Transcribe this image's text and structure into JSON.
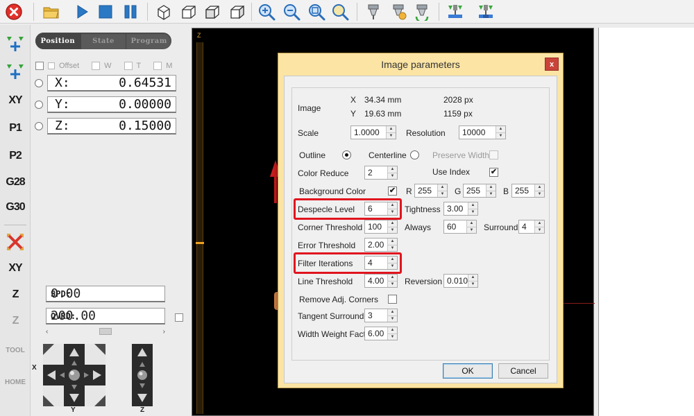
{
  "toolbar": {
    "icons": [
      "stop-icon",
      "open-folder-icon",
      "play-icon",
      "stop-square-icon",
      "pause-icon",
      "cube-view-1-icon",
      "cube-view-2-icon",
      "cube-view-3-icon",
      "cube-view-4-icon",
      "zoom-in-icon",
      "zoom-out-icon",
      "zoom-fit-icon",
      "zoom-window-icon",
      "spindle-icon",
      "spindle-tool-icon",
      "spindle-reset-icon",
      "probe-1-icon",
      "probe-2-icon"
    ]
  },
  "left_strip": {
    "xy_label": "XY",
    "p1_label": "P1",
    "p2_label": "P2",
    "g28_label": "G28",
    "g30_label": "G30",
    "xy2_label": "XY",
    "z_label": "Z",
    "z2_label": "Z",
    "tool_label": "TOOL",
    "home_label": "HOME"
  },
  "dro": {
    "tabs": [
      "Position",
      "State",
      "Program"
    ],
    "options": [
      "Offset",
      "W",
      "T",
      "M"
    ],
    "axes": [
      {
        "label": "X:",
        "value": "0.64531"
      },
      {
        "label": "Y:",
        "value": "0.00000"
      },
      {
        "label": "Z:",
        "value": "0.15000"
      }
    ],
    "spd_label": "SPD:",
    "spd_value": "0.00",
    "ovrd_label": "OVRD:",
    "ovrd_value": "200.00",
    "jog_x_label": "X",
    "jog_y_label": "Y",
    "jog_z_label": "Z"
  },
  "canvas": {
    "ruler_label": "Z"
  },
  "dialog": {
    "title": "Image parameters",
    "close_label": "x",
    "image_label": "Image",
    "x_axis": "X",
    "y_axis": "Y",
    "x_mm": "34.34 mm",
    "y_mm": "19.63 mm",
    "x_px": "2028 px",
    "y_px": "1159 px",
    "scale_label": "Scale",
    "scale_value": "1.0000",
    "resolution_label": "Resolution",
    "resolution_value": "10000",
    "outline_label": "Outline",
    "centerline_label": "Centerline",
    "preserve_width_label": "Preserve Width",
    "color_reduce_label": "Color Reduce",
    "color_reduce_value": "2",
    "use_index_label": "Use Index",
    "bg_color_label": "Background Color",
    "r_label": "R",
    "r_value": "255",
    "g_label": "G",
    "g_value": "255",
    "b_label": "B",
    "b_value": "255",
    "despecle_label": "Despecle Level",
    "despecle_value": "6",
    "tightness_label": "Tightness",
    "tightness_value": "3.00",
    "corner_threshold_label": "Corner Threshold",
    "corner_threshold_value": "100",
    "always_label": "Always",
    "always_value": "60",
    "surround_label": "Surround",
    "surround_value": "4",
    "error_threshold_label": "Error Threshold",
    "error_threshold_value": "2.00",
    "filter_iterations_label": "Filter Iterations",
    "filter_iterations_value": "4",
    "line_threshold_label": "Line Threshold",
    "line_threshold_value": "4.00",
    "reversion_label": "Reversion",
    "reversion_value": "0.010",
    "remove_corners_label": "Remove Adj. Corners",
    "tangent_surround_label": "Tangent Surround",
    "tangent_surround_value": "3",
    "width_weight_label": "Width Weight Fact.",
    "width_weight_value": "6.00",
    "ok_label": "OK",
    "cancel_label": "Cancel",
    "check_mark": "✔"
  },
  "colors": {
    "dialog_title_bg": "#fbe4a4",
    "highlight": "#e0141e",
    "canvas_bg": "#000000"
  }
}
